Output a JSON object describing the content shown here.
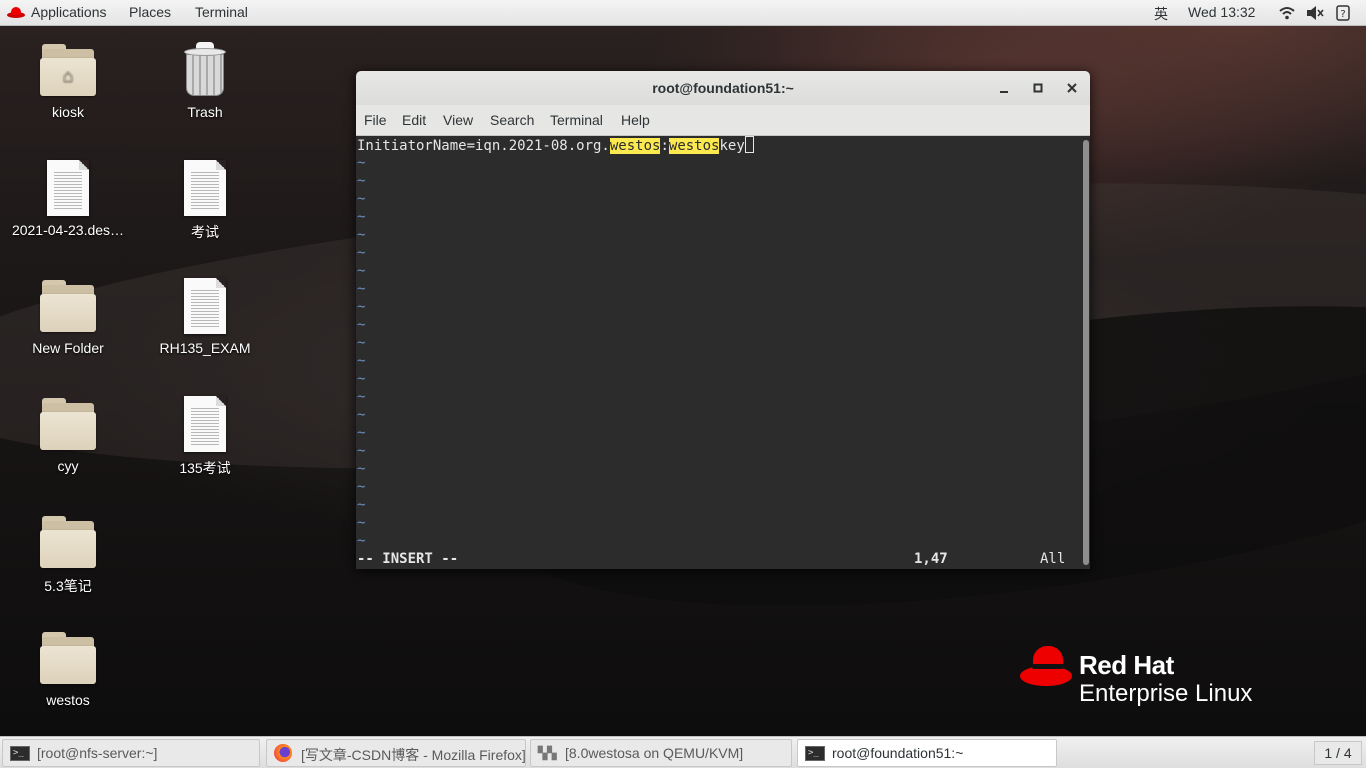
{
  "topbar": {
    "applications": "Applications",
    "places": "Places",
    "terminal": "Terminal",
    "input_method": "英",
    "clock": "Wed 13:32",
    "icons": [
      "wifi-icon",
      "volume-icon",
      "power-icon"
    ]
  },
  "desktop": {
    "icons": [
      {
        "label": "kiosk",
        "type": "home-folder"
      },
      {
        "label": "Trash",
        "type": "trash"
      },
      {
        "label": "2021-04-23.des…",
        "type": "document"
      },
      {
        "label": "考试",
        "type": "document"
      },
      {
        "label": "New Folder",
        "type": "folder"
      },
      {
        "label": "RH135_EXAM",
        "type": "document"
      },
      {
        "label": "cyy",
        "type": "folder"
      },
      {
        "label": "135考试",
        "type": "document"
      },
      {
        "label": "5.3笔记",
        "type": "folder"
      },
      {
        "label": "westos",
        "type": "folder"
      }
    ]
  },
  "terminal_window": {
    "title": "root@foundation51:~",
    "buttons": {
      "minimize": "minimize-icon",
      "maximize": "maximize-icon",
      "close": "close-icon"
    },
    "menu": [
      "File",
      "Edit",
      "View",
      "Search",
      "Terminal",
      "Help"
    ],
    "editor": {
      "line_prefix": "InitiatorName=iqn.2021-08.org.",
      "highlight1": "westos",
      "separator": ":",
      "highlight2": "westos",
      "line_suffix": "key",
      "tilde": "~",
      "mode": "-- INSERT --",
      "position": "1,47",
      "scroll": "All"
    }
  },
  "branding": {
    "name": "Red Hat",
    "product": "Enterprise Linux"
  },
  "taskbar": {
    "tasks": [
      {
        "label": "[root@nfs-server:~]",
        "icon": "terminal-icon",
        "active": false
      },
      {
        "label": "[写文章-CSDN博客 - Mozilla Firefox]",
        "icon": "firefox-icon",
        "active": false
      },
      {
        "label": "[8.0westosa on QEMU/KVM]",
        "icon": "virt-manager-icon",
        "active": false
      },
      {
        "label": "root@foundation51:~",
        "icon": "terminal-icon",
        "active": true
      }
    ],
    "workspace": "1 / 4"
  },
  "colors": {
    "highlight": "#fce94f",
    "terminal_bg": "#2c2c2c",
    "tilde": "#6a8ec3",
    "redhat": "#ee0000"
  }
}
